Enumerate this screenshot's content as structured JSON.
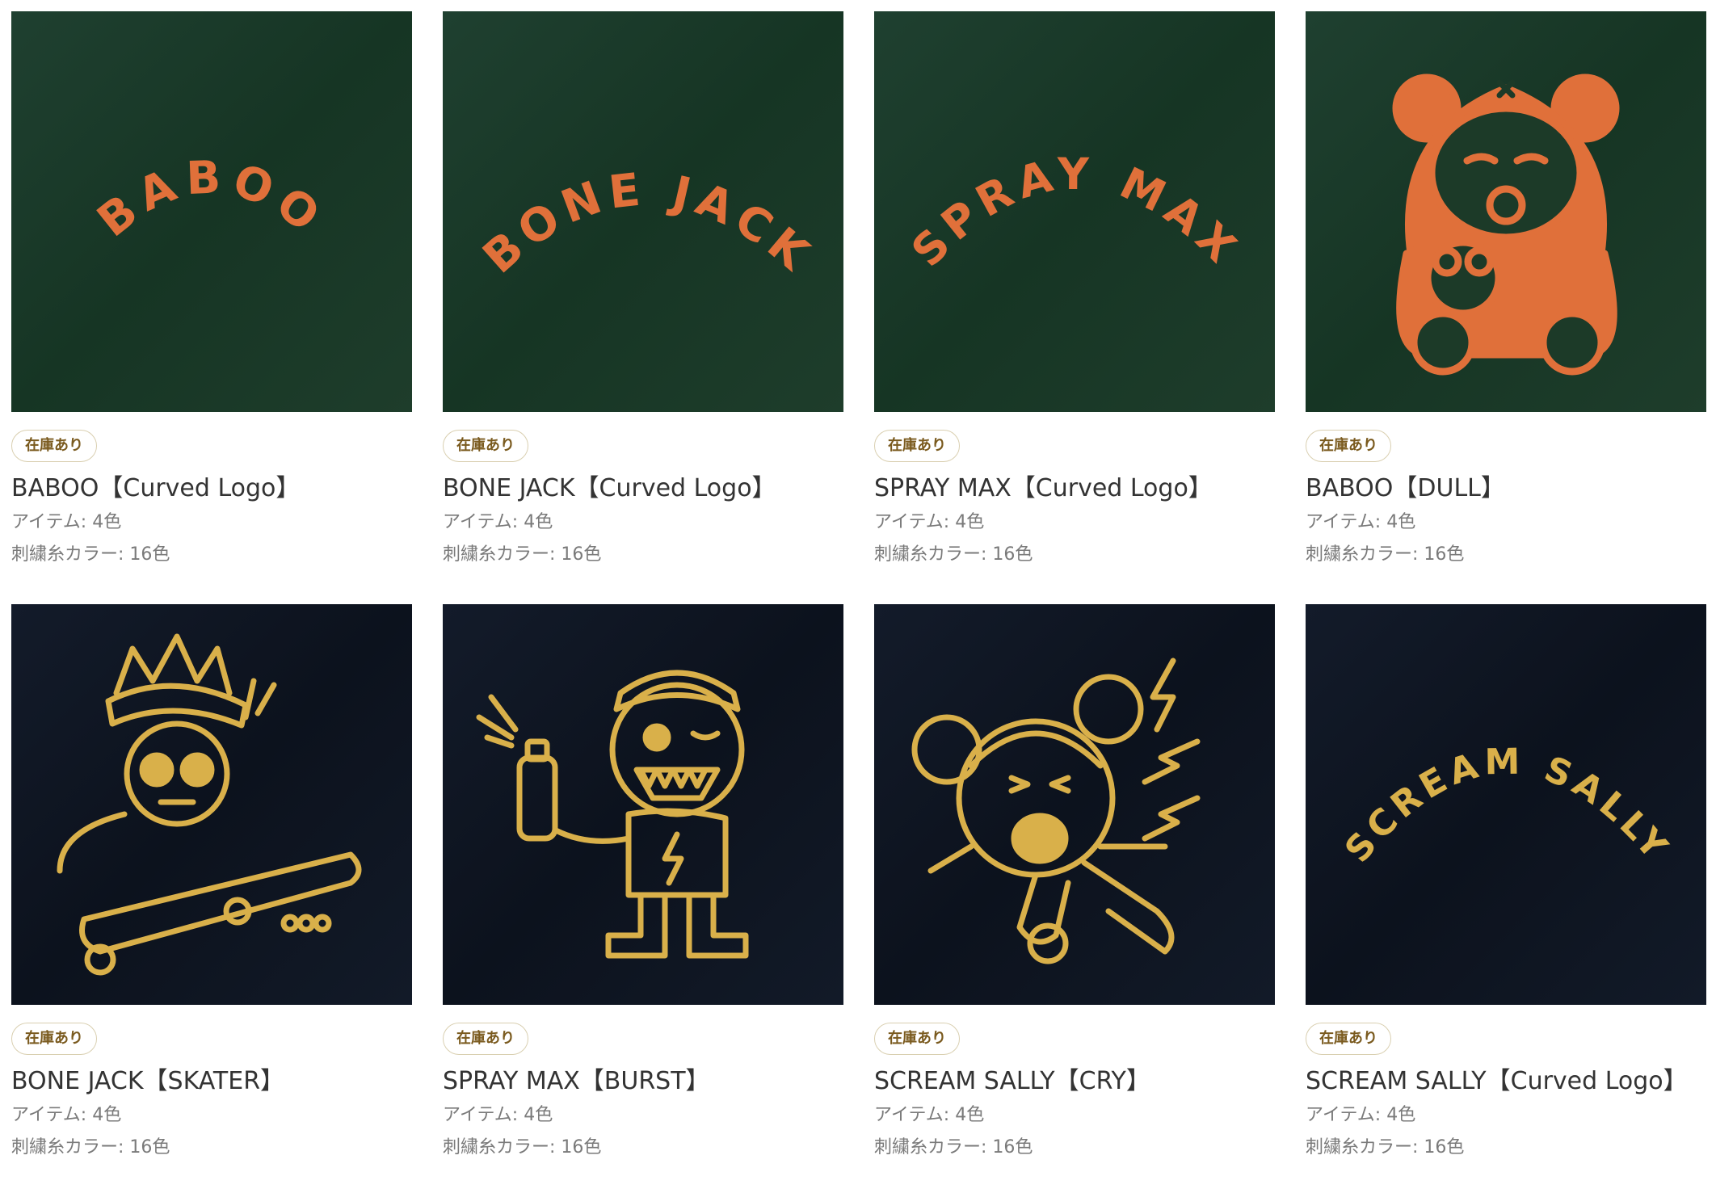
{
  "colors": {
    "green_fabric": "#1c3a28",
    "navy_fabric": "#0f1623",
    "orange_thread": "#e0703a",
    "gold_thread": "#d9b04a"
  },
  "products": [
    {
      "badge": "在庫あり",
      "title": "BABOO【Curved Logo】",
      "items": "アイテム: 4色",
      "thread": "刺繍糸カラー: 16色",
      "art_text": "BABOO",
      "fabric": "green",
      "art": "curved"
    },
    {
      "badge": "在庫あり",
      "title": "BONE JACK【Curved Logo】",
      "items": "アイテム: 4色",
      "thread": "刺繍糸カラー: 16色",
      "art_text": "BONE JACK",
      "fabric": "green",
      "art": "curved"
    },
    {
      "badge": "在庫あり",
      "title": "SPRAY MAX【Curved Logo】",
      "items": "アイテム: 4色",
      "thread": "刺繍糸カラー: 16色",
      "art_text": "SPRAY MAX",
      "fabric": "green",
      "art": "curved"
    },
    {
      "badge": "在庫あり",
      "title": "BABOO【DULL】",
      "items": "アイテム: 4色",
      "thread": "刺繍糸カラー: 16色",
      "art_text": "",
      "fabric": "green",
      "art": "bear"
    },
    {
      "badge": "在庫あり",
      "title": "BONE JACK【SKATER】",
      "items": "アイテム: 4色",
      "thread": "刺繍糸カラー: 16色",
      "art_text": "",
      "fabric": "navy",
      "art": "skater"
    },
    {
      "badge": "在庫あり",
      "title": "SPRAY MAX【BURST】",
      "items": "アイテム: 4色",
      "thread": "刺繍糸カラー: 16色",
      "art_text": "",
      "fabric": "navy",
      "art": "spray"
    },
    {
      "badge": "在庫あり",
      "title": "SCREAM SALLY【CRY】",
      "items": "アイテム: 4色",
      "thread": "刺繍糸カラー: 16色",
      "art_text": "",
      "fabric": "navy",
      "art": "cry"
    },
    {
      "badge": "在庫あり",
      "title": "SCREAM SALLY【Curved Logo】",
      "items": "アイテム: 4色",
      "thread": "刺繍糸カラー: 16色",
      "art_text": "SCREAM SALLY",
      "fabric": "navy",
      "art": "curved"
    }
  ]
}
